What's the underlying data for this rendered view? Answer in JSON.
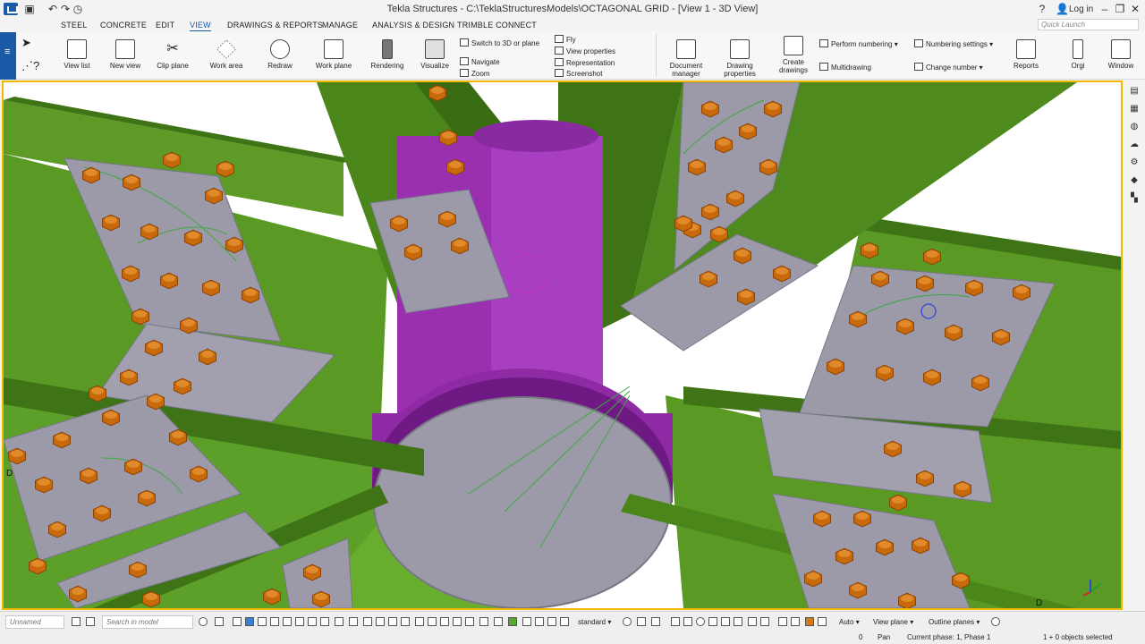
{
  "titlebar": {
    "title": "Tekla Structures - C:\\TeklaStructuresModels\\OCTAGONAL GRID - [View 1 - 3D View]",
    "login": "Log in"
  },
  "menu": {
    "tabs": [
      "STEEL",
      "CONCRETE",
      "EDIT",
      "VIEW",
      "DRAWINGS & REPORTS",
      "MANAGE",
      "ANALYSIS & DESIGN",
      "TRIMBLE CONNECT"
    ],
    "active": "VIEW",
    "quick_launch_placeholder": "Quick Launch"
  },
  "ribbon": {
    "view_list": "View list",
    "new_view": "New view",
    "clip_plane": "Clip plane",
    "work_area": "Work area",
    "redraw": "Redraw",
    "work_plane": "Work plane",
    "rendering": "Rendering",
    "visualize": "Visualize",
    "switch_3d": "Switch to 3D or plane",
    "navigate": "Navigate",
    "zoom": "Zoom",
    "fly": "Fly",
    "view_properties": "View properties",
    "representation": "Representation",
    "screenshot": "Screenshot",
    "document_manager_1": "Document",
    "document_manager_2": "manager",
    "drawing_properties_1": "Drawing",
    "drawing_properties_2": "properties",
    "create_drawings_1": "Create",
    "create_drawings_2": "drawings",
    "perform_numbering": "Perform numbering",
    "numbering_settings": "Numbering settings",
    "multidrawing": "Multidrawing",
    "change_number": "Change number",
    "reports": "Reports",
    "orgi": "Orgi",
    "window": "Window"
  },
  "viewport": {
    "label_d_left": "D",
    "label_d_right": "D"
  },
  "statusbar": {
    "unnamed": "Unnamed",
    "search_placeholder": "Search in model",
    "standard": "standard",
    "auto": "Auto",
    "view_plane": "View plane",
    "outline_planes": "Outline planes",
    "zero": "0",
    "pan": "Pan",
    "current_phase": "Current phase: 1, Phase 1",
    "objects_selected": "1 + 0 objects selected"
  },
  "colors": {
    "steel_green": "#4e8a1e",
    "column_purple": "#9a2fb0",
    "plate_grey": "#9c9aa8",
    "bolt_orange": "#c8690c",
    "accent_blue": "#1a5aa6",
    "viewport_border": "#f2b700"
  }
}
